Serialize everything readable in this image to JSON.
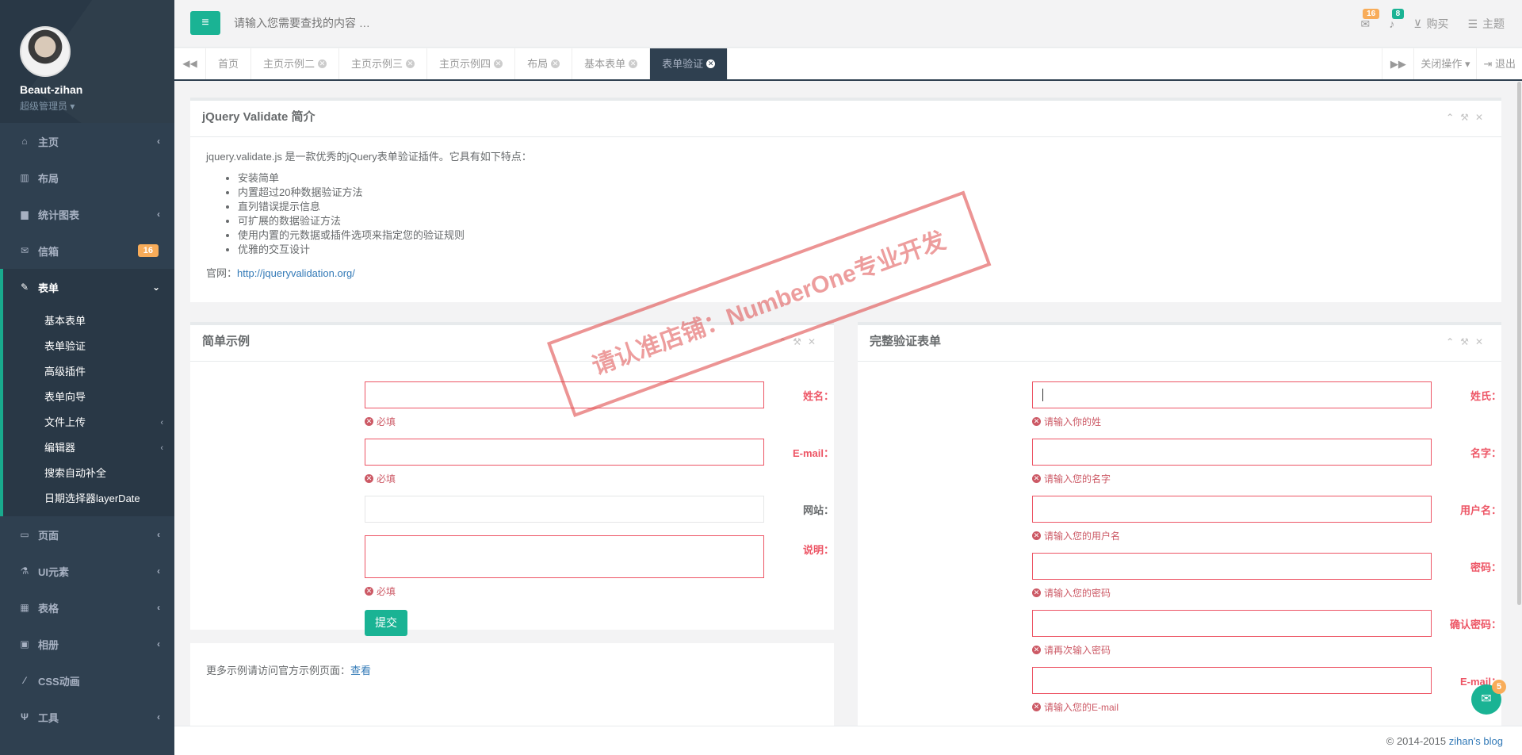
{
  "profile": {
    "name": "Beaut-zihan",
    "role": "超级管理员 ▾"
  },
  "sidebar": {
    "items": [
      {
        "label": "主页",
        "icon": "home-icon",
        "glyph": "⌂",
        "chev": "‹"
      },
      {
        "label": "布局",
        "icon": "columns-icon",
        "glyph": "▥",
        "chev": ""
      },
      {
        "label": "统计图表",
        "icon": "chart-icon",
        "glyph": "▆",
        "chev": "‹"
      },
      {
        "label": "信箱",
        "icon": "envelope-icon",
        "glyph": "✉",
        "badge": "16"
      },
      {
        "label": "表单",
        "icon": "edit-icon",
        "glyph": "✎",
        "chev": "⌄"
      },
      {
        "label": "页面",
        "icon": "desktop-icon",
        "glyph": "▭",
        "chev": "‹"
      },
      {
        "label": "UI元素",
        "icon": "flask-icon",
        "glyph": "⚗",
        "chev": "‹"
      },
      {
        "label": "表格",
        "icon": "table-icon",
        "glyph": "▦",
        "chev": "‹"
      },
      {
        "label": "相册",
        "icon": "picture-icon",
        "glyph": "▣",
        "chev": "‹"
      },
      {
        "label": "CSS动画",
        "icon": "magic-icon",
        "glyph": "⁄",
        "chev": ""
      },
      {
        "label": "工具",
        "icon": "cutlery-icon",
        "glyph": "Ψ",
        "chev": "‹"
      }
    ],
    "submenu": [
      {
        "label": "基本表单",
        "chev": ""
      },
      {
        "label": "表单验证",
        "chev": ""
      },
      {
        "label": "高级插件",
        "chev": ""
      },
      {
        "label": "表单向导",
        "chev": ""
      },
      {
        "label": "文件上传",
        "chev": "‹"
      },
      {
        "label": "编辑器",
        "chev": "‹"
      },
      {
        "label": "搜索自动补全",
        "chev": ""
      },
      {
        "label": "日期选择器layerDate",
        "chev": ""
      }
    ]
  },
  "topbar": {
    "menu_glyph": "≡",
    "search_placeholder": "请输入您需要查找的内容 …",
    "mail_badge": "16",
    "bell_badge": "8",
    "buy_label": "购买",
    "theme_label": "主题"
  },
  "tabs": {
    "items": [
      "首页",
      "主页示例二",
      "主页示例三",
      "主页示例四",
      "布局",
      "基本表单",
      "表单验证"
    ],
    "close_ops": "关闭操作 ▾",
    "logout": "退出"
  },
  "intro": {
    "title": "jQuery Validate 简介",
    "desc": "jquery.validate.js 是一款优秀的jQuery表单验证插件。它具有如下特点：",
    "features": [
      "安装简单",
      "内置超过20种数据验证方法",
      "直列错误提示信息",
      "可扩展的数据验证方法",
      "使用内置的元数据或插件选项来指定您的验证规则",
      "优雅的交互设计"
    ],
    "site_label": "官网：",
    "site_url": "http://jqueryvalidation.org/"
  },
  "simple": {
    "title": "简单示例",
    "fields": [
      {
        "label": "姓名：",
        "error": "必填"
      },
      {
        "label": "E-mail：",
        "error": "必填"
      },
      {
        "label": "网站：",
        "error": ""
      },
      {
        "label": "说明：",
        "error": "必填"
      }
    ],
    "submit": "提交",
    "more_text": "更多示例请访问官方示例页面：",
    "more_link": "查看"
  },
  "full": {
    "title": "完整验证表单",
    "fields": [
      {
        "label": "姓氏：",
        "error": "请输入你的姓"
      },
      {
        "label": "名字：",
        "error": "请输入您的名字"
      },
      {
        "label": "用户名：",
        "error": "请输入您的用户名"
      },
      {
        "label": "密码：",
        "error": "请输入您的密码"
      },
      {
        "label": "确认密码：",
        "error": "请再次输入密码"
      },
      {
        "label": "E-mail：",
        "error": "请输入您的E-mail"
      }
    ]
  },
  "footer": {
    "copyright": "© 2014-2015 ",
    "link": "zihan's blog"
  },
  "chat": {
    "badge": "5"
  },
  "watermark": {
    "text": "请认准店铺：NumberOne专业开发"
  },
  "colors": {
    "accent": "#1ab394",
    "sidebar": "#2f4050",
    "error": "#ed5565",
    "warning": "#f8ac59"
  }
}
